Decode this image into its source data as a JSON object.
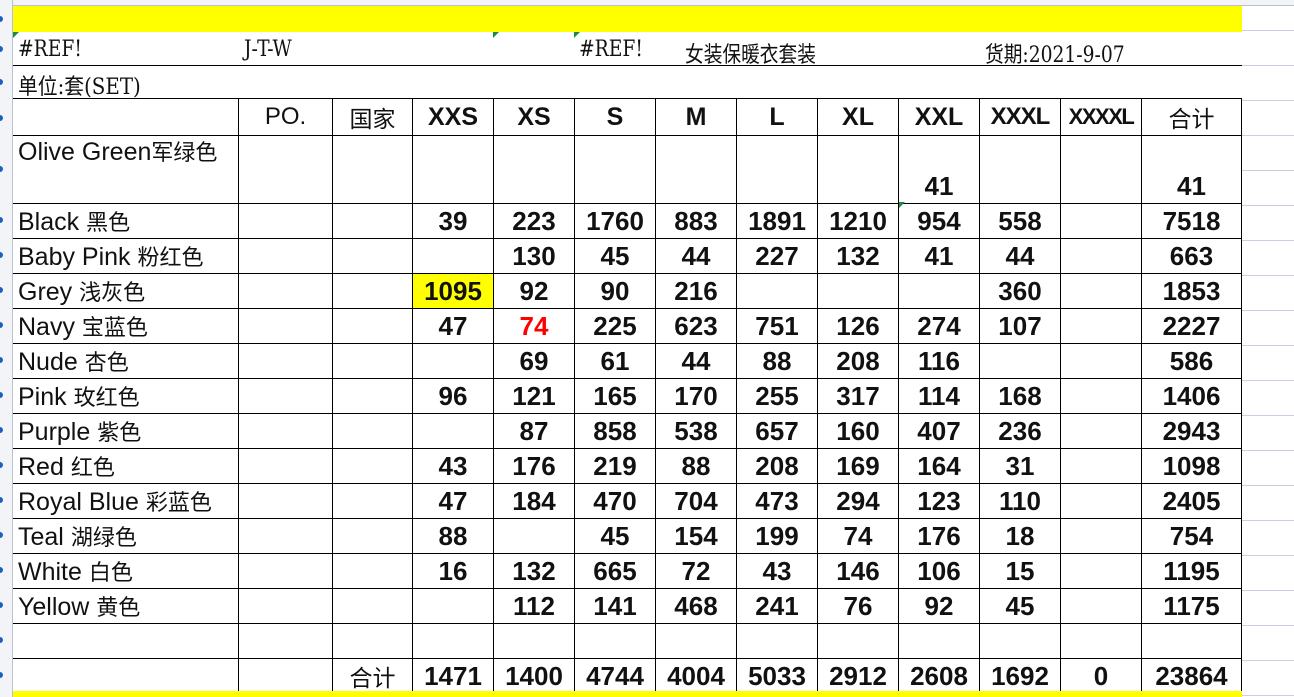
{
  "sheet": {
    "header_line": {
      "ref1": "#REF!",
      "code": "J-T-W",
      "ref2": "#REF!",
      "product": "女装保暖衣套装",
      "delivery": "货期:2021-9-07"
    },
    "unit_label": "单位:套(SET)",
    "columns": {
      "po": "PO.",
      "country": "国家",
      "sizes": [
        "XXS",
        "XS",
        "S",
        "M",
        "L",
        "XL",
        "XXL",
        "XXXL",
        "XXXXL"
      ],
      "total": "合计"
    },
    "rows": [
      {
        "color_en": "Olive Green",
        "color_zh": "军绿色",
        "values": [
          "",
          "",
          "",
          "",
          "",
          "",
          "41",
          "",
          ""
        ],
        "total": "41"
      },
      {
        "color_en": "Black ",
        "color_zh": "黑色",
        "values": [
          "39",
          "223",
          "1760",
          "883",
          "1891",
          "1210",
          "954",
          "558",
          ""
        ],
        "total": "7518"
      },
      {
        "color_en": "Baby Pink ",
        "color_zh": "粉红色",
        "values": [
          "",
          "130",
          "45",
          "44",
          "227",
          "132",
          "41",
          "44",
          ""
        ],
        "total": "663"
      },
      {
        "color_en": "Grey ",
        "color_zh": "浅灰色",
        "values": [
          "1095",
          "92",
          "90",
          "216",
          "",
          "",
          "",
          "360",
          ""
        ],
        "total": "1853"
      },
      {
        "color_en": "Navy ",
        "color_zh": "宝蓝色",
        "values": [
          "47",
          "74",
          "225",
          "623",
          "751",
          "126",
          "274",
          "107",
          ""
        ],
        "total": "2227"
      },
      {
        "color_en": "Nude ",
        "color_zh": "杏色",
        "values": [
          "",
          "69",
          "61",
          "44",
          "88",
          "208",
          "116",
          "",
          ""
        ],
        "total": "586"
      },
      {
        "color_en": "Pink ",
        "color_zh": "玫红色",
        "values": [
          "96",
          "121",
          "165",
          "170",
          "255",
          "317",
          "114",
          "168",
          ""
        ],
        "total": "1406"
      },
      {
        "color_en": "Purple ",
        "color_zh": "紫色",
        "values": [
          "",
          "87",
          "858",
          "538",
          "657",
          "160",
          "407",
          "236",
          ""
        ],
        "total": "2943"
      },
      {
        "color_en": "Red ",
        "color_zh": "红色",
        "values": [
          "43",
          "176",
          "219",
          "88",
          "208",
          "169",
          "164",
          "31",
          ""
        ],
        "total": "1098"
      },
      {
        "color_en": "Royal Blue ",
        "color_zh": "彩蓝色",
        "values": [
          "47",
          "184",
          "470",
          "704",
          "473",
          "294",
          "123",
          "110",
          ""
        ],
        "total": "2405"
      },
      {
        "color_en": "Teal ",
        "color_zh": "湖绿色",
        "values": [
          "88",
          "",
          "45",
          "154",
          "199",
          "74",
          "176",
          "18",
          ""
        ],
        "total": "754"
      },
      {
        "color_en": "White ",
        "color_zh": "白色",
        "values": [
          "16",
          "132",
          "665",
          "72",
          "43",
          "146",
          "106",
          "15",
          ""
        ],
        "total": "1195"
      },
      {
        "color_en": "Yellow ",
        "color_zh": "黄色",
        "values": [
          "",
          "112",
          "141",
          "468",
          "241",
          "76",
          "92",
          "45",
          ""
        ],
        "total": "1175"
      }
    ],
    "totals_row": {
      "label": "合计",
      "values": [
        "1471",
        "1400",
        "4744",
        "4004",
        "5033",
        "2912",
        "2608",
        "1692",
        "0"
      ],
      "grand_total": "23864"
    },
    "highlights": {
      "yellow_fill": "#ffff00",
      "red_text": "#ff0000",
      "yellow_cell": "Grey/XXS",
      "red_cell": "Navy/XS"
    }
  }
}
